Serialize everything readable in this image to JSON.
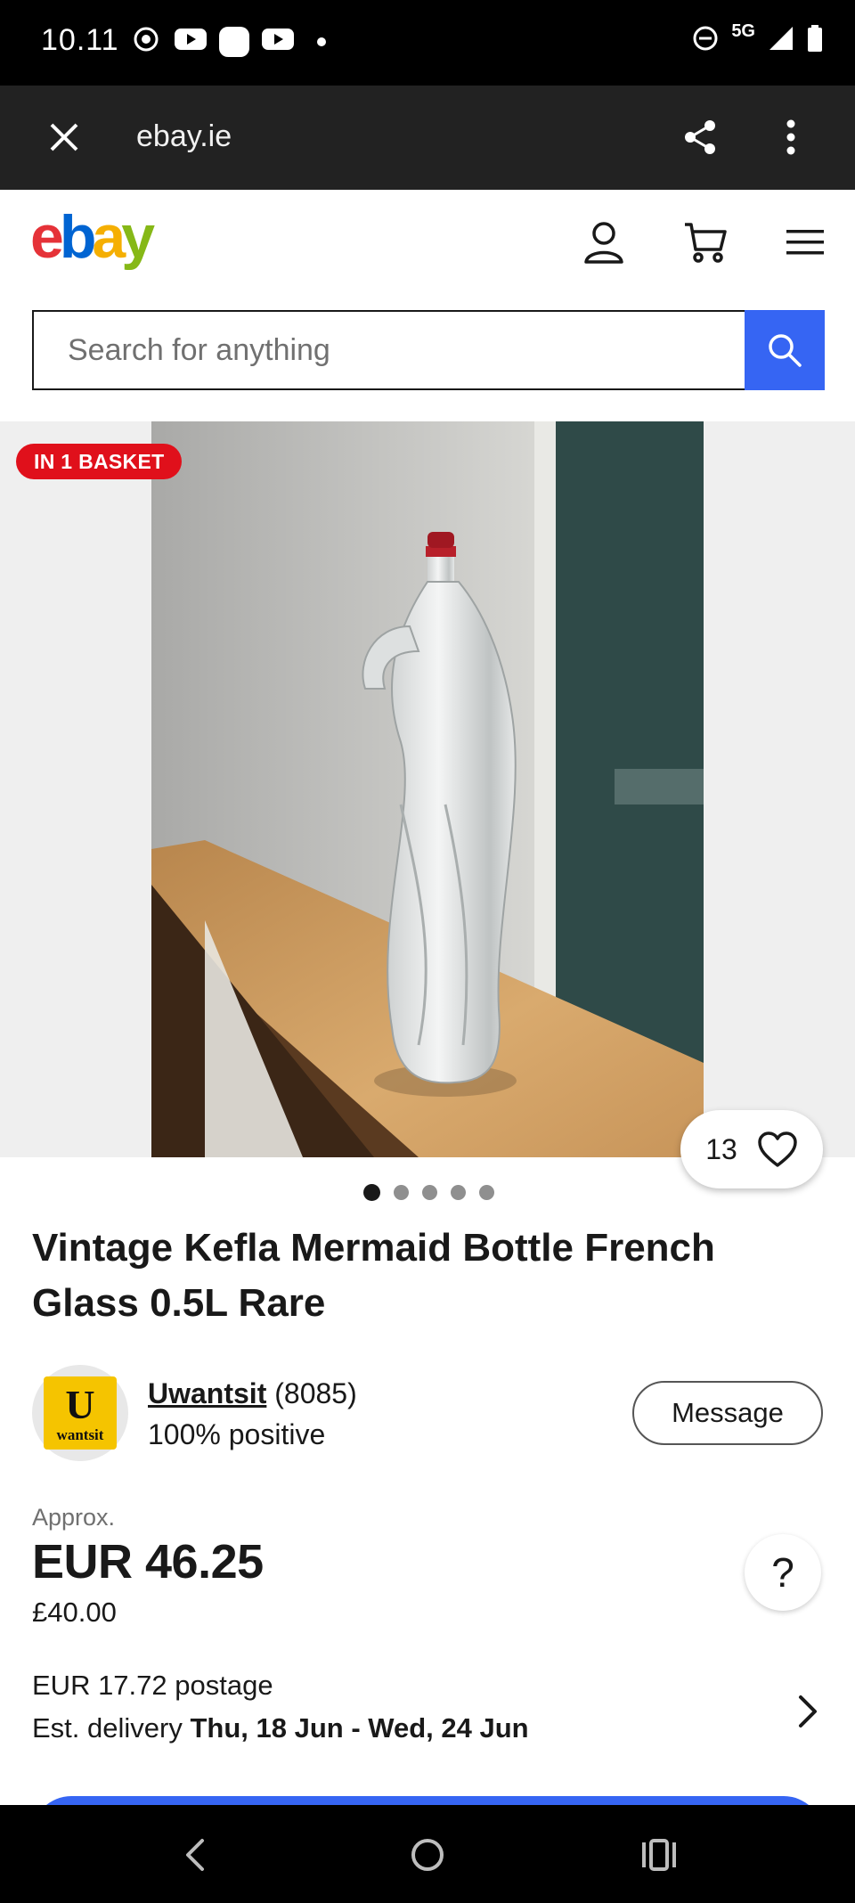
{
  "status_bar": {
    "time": "10.11",
    "network": "5G"
  },
  "browser": {
    "url": "ebay.ie"
  },
  "header": {
    "logo": {
      "e": "e",
      "b": "b",
      "a": "a",
      "y": "y"
    },
    "search_placeholder": "Search for anything"
  },
  "gallery": {
    "badge": "IN 1 BASKET",
    "watch_count": "13",
    "image_count": 5,
    "active_image": 1
  },
  "product": {
    "title": "Vintage Kefla Mermaid Bottle French Glass 0.5L Rare"
  },
  "seller": {
    "avatar_letter": "U",
    "avatar_text": "wantsit",
    "name": "Uwantsit",
    "feedback_count": "(8085)",
    "positive": "100% positive",
    "message_label": "Message"
  },
  "price": {
    "approx_label": "Approx.",
    "main": "EUR 46.25",
    "original": "£40.00",
    "help": "?"
  },
  "shipping": {
    "postage": "EUR 17.72 postage",
    "delivery_label": "Est. delivery",
    "delivery_dates": "Thu, 18 Jun - Wed, 24 Jun"
  },
  "colors": {
    "ebay_red": "#e53238",
    "ebay_blue": "#0064d2",
    "ebay_yellow": "#f5af02",
    "ebay_green": "#86b817",
    "accent_blue": "#3665f3",
    "badge_red": "#e0101b"
  }
}
